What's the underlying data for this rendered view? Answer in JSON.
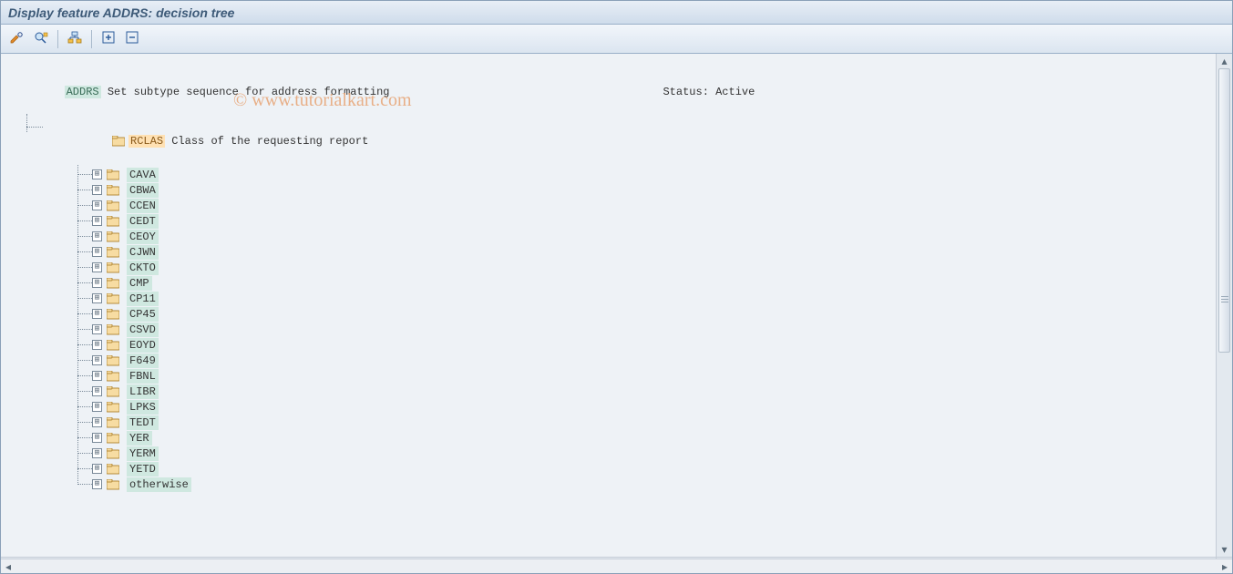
{
  "title": "Display feature ADDRS: decision tree",
  "watermark": "© www.tutorialkart.com",
  "toolbar": {
    "btn_change": "change-display-icon",
    "btn_check": "check-icon",
    "btn_other": "other-object-icon",
    "btn_expand": "expand-icon",
    "btn_collapse": "collapse-icon"
  },
  "tree": {
    "root_code": "ADDRS",
    "root_text": " Set subtype sequence for address formatting",
    "status_label": "Status: ",
    "status_value": "Active",
    "rclas_code": "RCLAS",
    "rclas_text": " Class of the requesting report",
    "children": [
      "CAVA",
      "CBWA",
      "CCEN",
      "CEDT",
      "CEOY",
      "CJWN",
      "CKTO",
      "CMP",
      "CP11",
      "CP45",
      "CSVD",
      "EOYD",
      "F649",
      "FBNL",
      "LIBR",
      "LPKS",
      "TEDT",
      "YER",
      "YERM",
      "YETD",
      "otherwise"
    ]
  }
}
